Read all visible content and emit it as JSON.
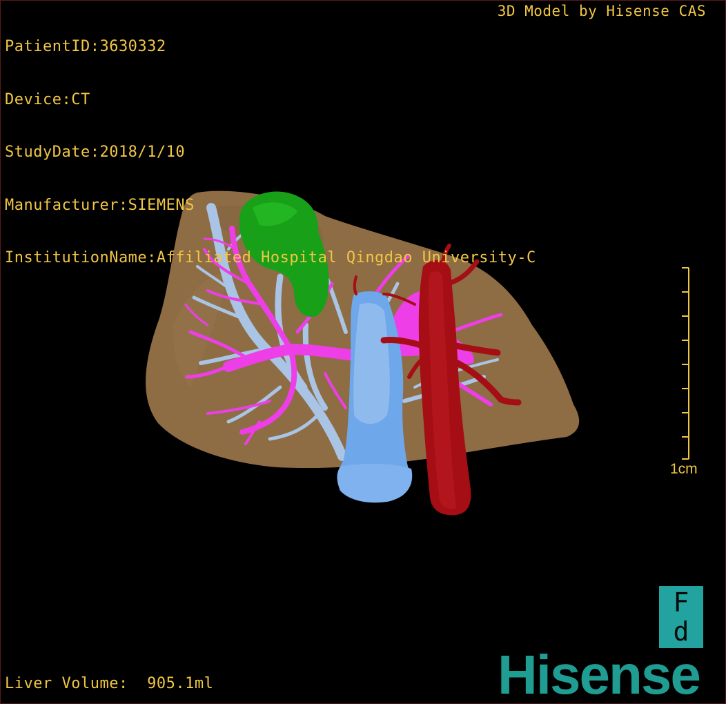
{
  "header": {
    "patient_id": "PatientID:3630332",
    "device": "Device:CT",
    "study_date": "StudyDate:2018/1/10",
    "manufacturer": "Manufacturer:SIEMENS",
    "institution": "InstitutionName:Affiliated Hospital Qingdao University-C"
  },
  "credit": "3D Model by Hisense CAS",
  "footer": {
    "liver_volume": "Liver Volume:  905.1ml"
  },
  "scale_bar": {
    "label": "1cm"
  },
  "orientation": {
    "top_glyph": "F",
    "bottom_glyph": "d"
  },
  "brand": {
    "logo_text": "Hisense"
  },
  "colors": {
    "background": "#000000",
    "overlay_text": "#f2c744",
    "liver": "#8e6c44",
    "gallbladder": "#18a018",
    "hepatic_vein": "#a9c4e4",
    "portal_vein": "#ee3ee8",
    "vena_cava": "#6fa8ea",
    "aorta": "#a50e14",
    "brand": "#1f9d93"
  }
}
